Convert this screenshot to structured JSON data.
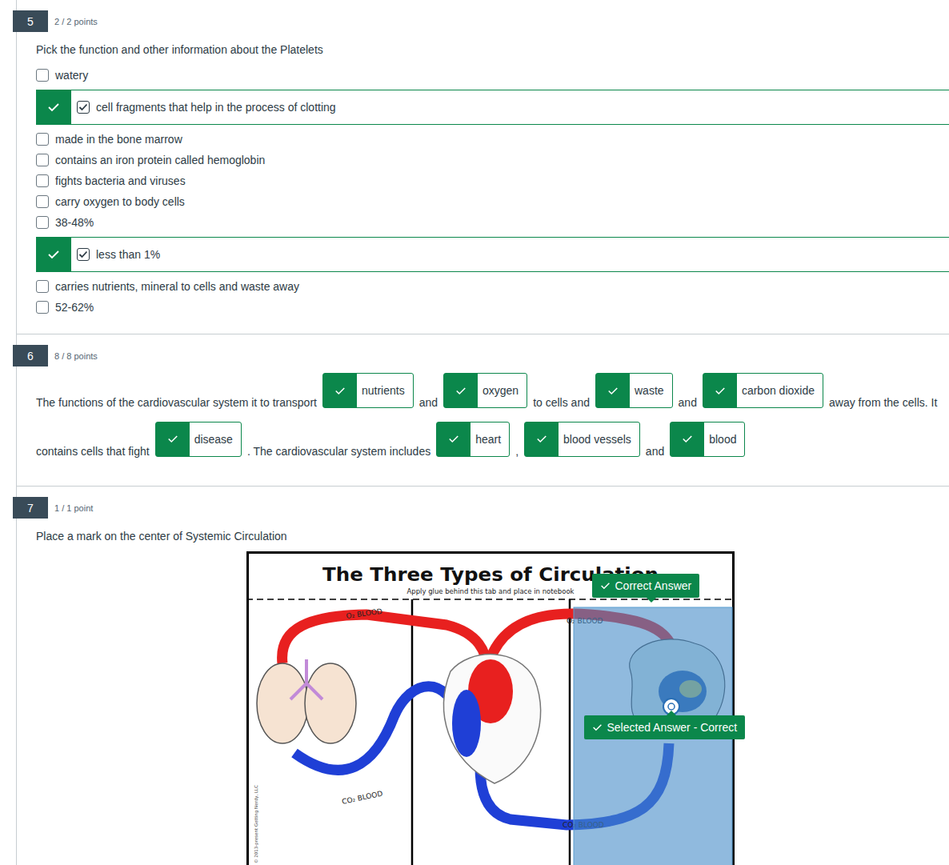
{
  "questions": [
    {
      "number": "5",
      "points": "2 / 2 points",
      "kind": "multiple",
      "prompt": "Pick the function and other information about the Platelets",
      "options": [
        {
          "label": "watery",
          "selected": false,
          "correct": false
        },
        {
          "label": "cell fragments that help in the process of clotting",
          "selected": true,
          "correct": true
        },
        {
          "label": "made in the bone marrow",
          "selected": false,
          "correct": false
        },
        {
          "label": "contains an iron protein called hemoglobin",
          "selected": false,
          "correct": false
        },
        {
          "label": "fights bacteria and viruses",
          "selected": false,
          "correct": false
        },
        {
          "label": "carry oxygen to body cells",
          "selected": false,
          "correct": false
        },
        {
          "label": "38-48%",
          "selected": false,
          "correct": false
        },
        {
          "label": "less than 1%",
          "selected": true,
          "correct": true
        },
        {
          "label": "carries nutrients, mineral to cells and waste away",
          "selected": false,
          "correct": false
        },
        {
          "label": "52-62%",
          "selected": false,
          "correct": false
        }
      ]
    },
    {
      "number": "6",
      "points": "8 / 8 points",
      "kind": "blanks",
      "prompt": "",
      "segments": [
        {
          "kind": "text",
          "text": "The functions of the cardiovascular system it to transport",
          "correct": false
        },
        {
          "kind": "blank",
          "text": "nutrients",
          "correct": true
        },
        {
          "kind": "text",
          "text": "and",
          "correct": false
        },
        {
          "kind": "blank",
          "text": "oxygen",
          "correct": true
        },
        {
          "kind": "text",
          "text": "to cells and",
          "correct": false
        },
        {
          "kind": "blank",
          "text": "waste",
          "correct": true
        },
        {
          "kind": "text",
          "text": "and",
          "correct": false
        },
        {
          "kind": "blank",
          "text": "carbon dioxide",
          "correct": true
        },
        {
          "kind": "text",
          "text": "away from the cells. It contains cells that fight",
          "correct": false
        },
        {
          "kind": "blank",
          "text": "disease",
          "correct": true
        },
        {
          "kind": "text",
          "text": ". The cardiovascular system includes",
          "correct": false
        },
        {
          "kind": "blank",
          "text": "heart",
          "correct": true
        },
        {
          "kind": "text",
          "text": ",",
          "correct": false
        },
        {
          "kind": "blank",
          "text": "blood vessels",
          "correct": true
        },
        {
          "kind": "text",
          "text": "and",
          "correct": false
        },
        {
          "kind": "blank",
          "text": "blood",
          "correct": true
        }
      ]
    },
    {
      "number": "7",
      "points": "1 / 1 point",
      "kind": "hotspot",
      "prompt": "Place a mark on the center of Systemic Circulation",
      "diagram": {
        "title": "The Three Types of Circulation",
        "subtitle": "Apply glue behind this tab and place in notebook",
        "labels": [
          "O₂ BLOOD",
          "O₂ BLOOD",
          "CO₂ BLOOD",
          "CO₂ BLOOD"
        ],
        "copyright": "© 2013-present Getting Nerdy, LLC",
        "hotspot": {
          "selected": true,
          "correct": true,
          "correct_label": "Correct Answer",
          "selected_label": "Selected Answer - Correct"
        }
      }
    }
  ]
}
